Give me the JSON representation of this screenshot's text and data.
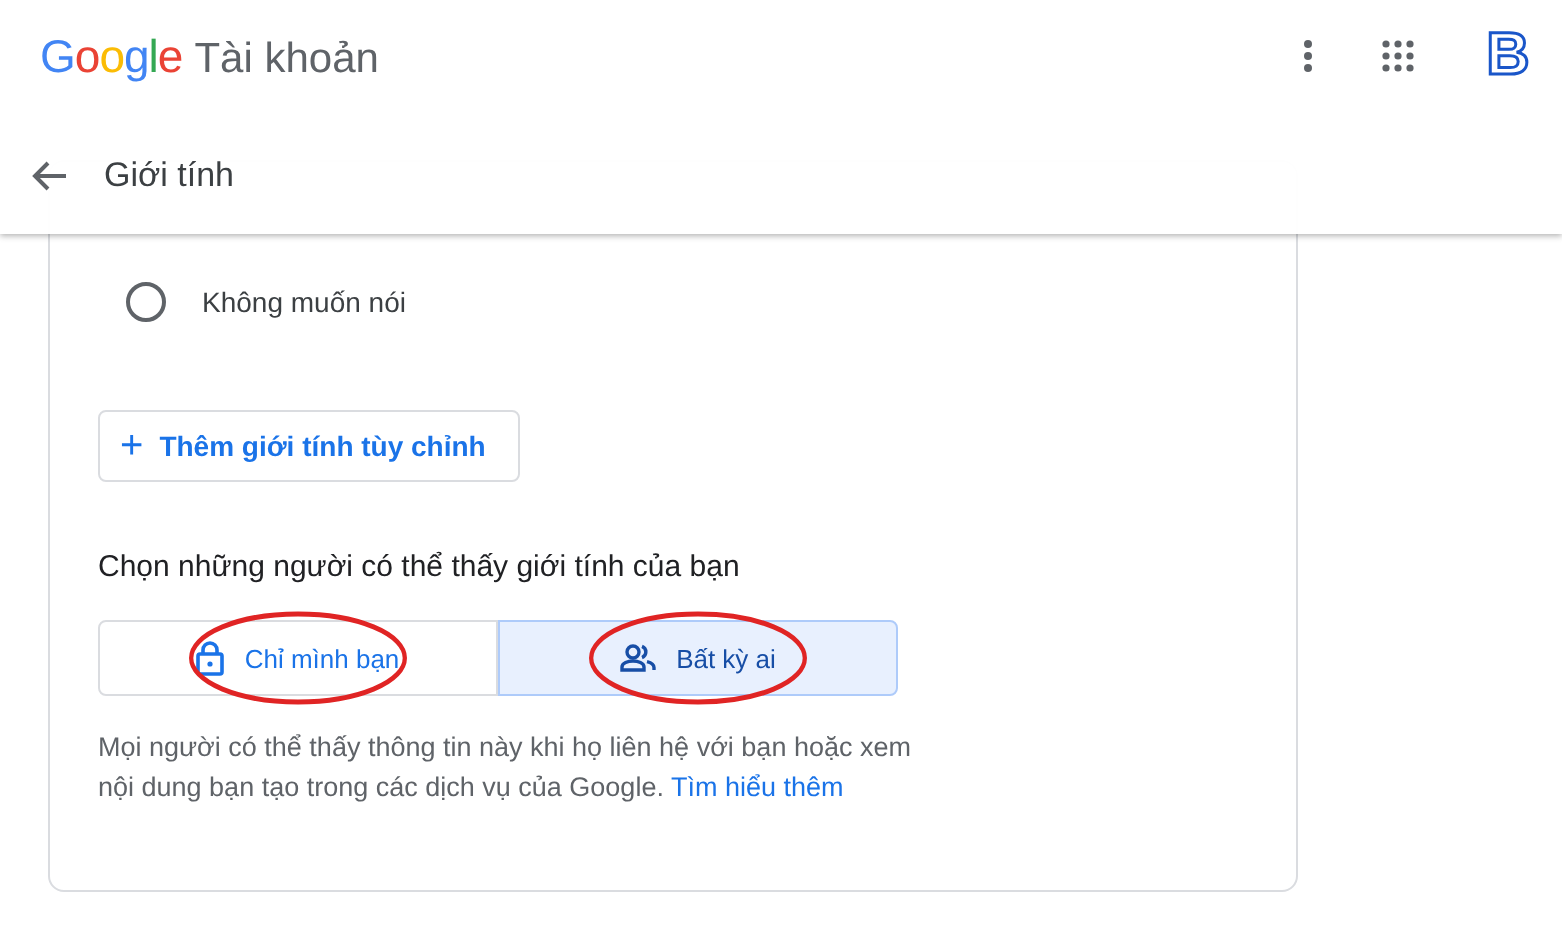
{
  "header": {
    "logo": "Google",
    "product": "Tài khoản",
    "avatar_letter": "B"
  },
  "subheader": {
    "title": "Giới tính"
  },
  "radio_options": [
    {
      "label": "Không muốn nói",
      "selected": false
    }
  ],
  "add_button": {
    "icon": "+",
    "label": "Thêm giới tính tùy chỉnh"
  },
  "visibility": {
    "heading": "Chọn những người có thể thấy giới tính của bạn",
    "options": [
      {
        "kind": "lock",
        "label": "Chỉ mình bạn",
        "selected": false,
        "circled": true
      },
      {
        "kind": "people",
        "label": "Bất kỳ ai",
        "selected": true,
        "circled": true
      }
    ],
    "description": "Mọi người có thể thấy thông tin này khi họ liên hệ với bạn hoặc xem nội dung bạn tạo trong các dịch vụ của Google.",
    "link": "Tìm hiểu thêm"
  }
}
